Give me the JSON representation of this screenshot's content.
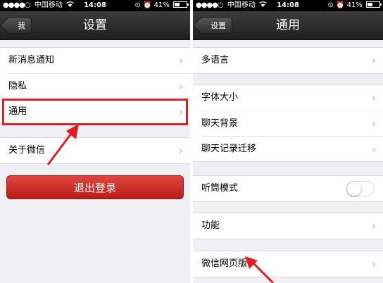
{
  "status_bar": {
    "signal": "●●●●○",
    "carrier": "中国移动",
    "wifi": "wifi-icon",
    "time": "14:08",
    "battery": "41%",
    "battery_level": 0.41
  },
  "left_screen": {
    "back_label": "我",
    "title": "设置",
    "groups": [
      [
        "新消息通知",
        "隐私",
        "通用"
      ],
      [
        "关于微信"
      ]
    ],
    "logout_label": "退出登录",
    "highlighted_item": "通用"
  },
  "right_screen": {
    "back_label": "设置",
    "title": "通用",
    "groups": [
      [
        "多语言"
      ],
      [
        "字体大小",
        "聊天背景",
        "聊天记录迁移"
      ],
      [
        "听筒模式"
      ],
      [
        "功能"
      ],
      [
        "微信网页版"
      ]
    ],
    "toggle_item": "听筒模式",
    "toggle_on": false
  },
  "colors": {
    "annotation": "#e21c23",
    "logout": "#c8241d"
  }
}
